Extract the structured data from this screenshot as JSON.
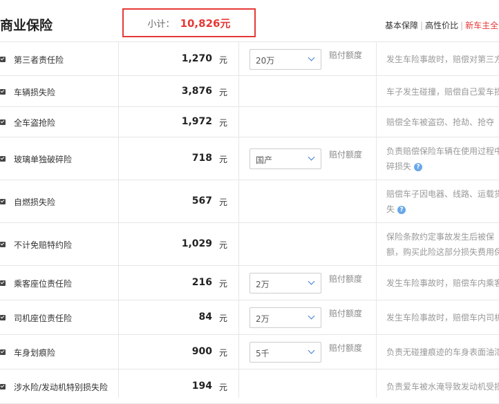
{
  "header": {
    "title": "商业保险",
    "subtotal_label": "小计：",
    "subtotal_value": "10,826元",
    "plans": [
      "基本保障",
      "高性价比",
      "新车主全"
    ]
  },
  "rows": [
    {
      "name": "第三者责任险",
      "price": "1,270",
      "unit": "元",
      "select": "20万",
      "amount_label": "赔付额度",
      "desc": [
        "发生车险事故时，赔偿对第三方"
      ]
    },
    {
      "name": "车辆损失险",
      "price": "3,876",
      "unit": "元",
      "desc": [
        "车子发生碰撞，赔偿自己爱车损"
      ]
    },
    {
      "name": "全车盗抢险",
      "price": "1,972",
      "unit": "元",
      "desc": [
        "赔偿全车被盗窃、抢劫、抢夺"
      ]
    },
    {
      "name": "玻璃单独破碎险",
      "price": "718",
      "unit": "元",
      "select": "国产",
      "amount_label": "赔付额度",
      "desc": [
        "负责赔偿保险车辆在使用过程中",
        "碎损失"
      ],
      "help": true
    },
    {
      "name": "自燃损失险",
      "price": "567",
      "unit": "元",
      "desc": [
        "赔偿车子因电器、线路、运载货",
        "失"
      ],
      "help": true
    },
    {
      "name": "不计免赔特约险",
      "price": "1,029",
      "unit": "元",
      "desc": [
        "保险条款约定事故发生后被保",
        "额，购买此险这部分损失费用保"
      ]
    },
    {
      "name": "乘客座位责任险",
      "price": "216",
      "unit": "元",
      "select": "2万",
      "amount_label": "赔付额度",
      "desc": [
        "发生车险事故时，赔偿车内乘客"
      ]
    },
    {
      "name": "司机座位责任险",
      "price": "84",
      "unit": "元",
      "select": "2万",
      "amount_label": "赔付额度",
      "desc": [
        "发生车险事故时，赔偿车内司机"
      ]
    },
    {
      "name": "车身划痕险",
      "price": "900",
      "unit": "元",
      "select": "5千",
      "amount_label": "赔付额度",
      "desc": [
        "负责无碰撞痕迹的车身表面油漆"
      ]
    },
    {
      "name": "涉水险/发动机特别损失险",
      "price": "194",
      "unit": "元",
      "desc": [
        "负责爱车被水淹导致发动机受损"
      ]
    }
  ]
}
